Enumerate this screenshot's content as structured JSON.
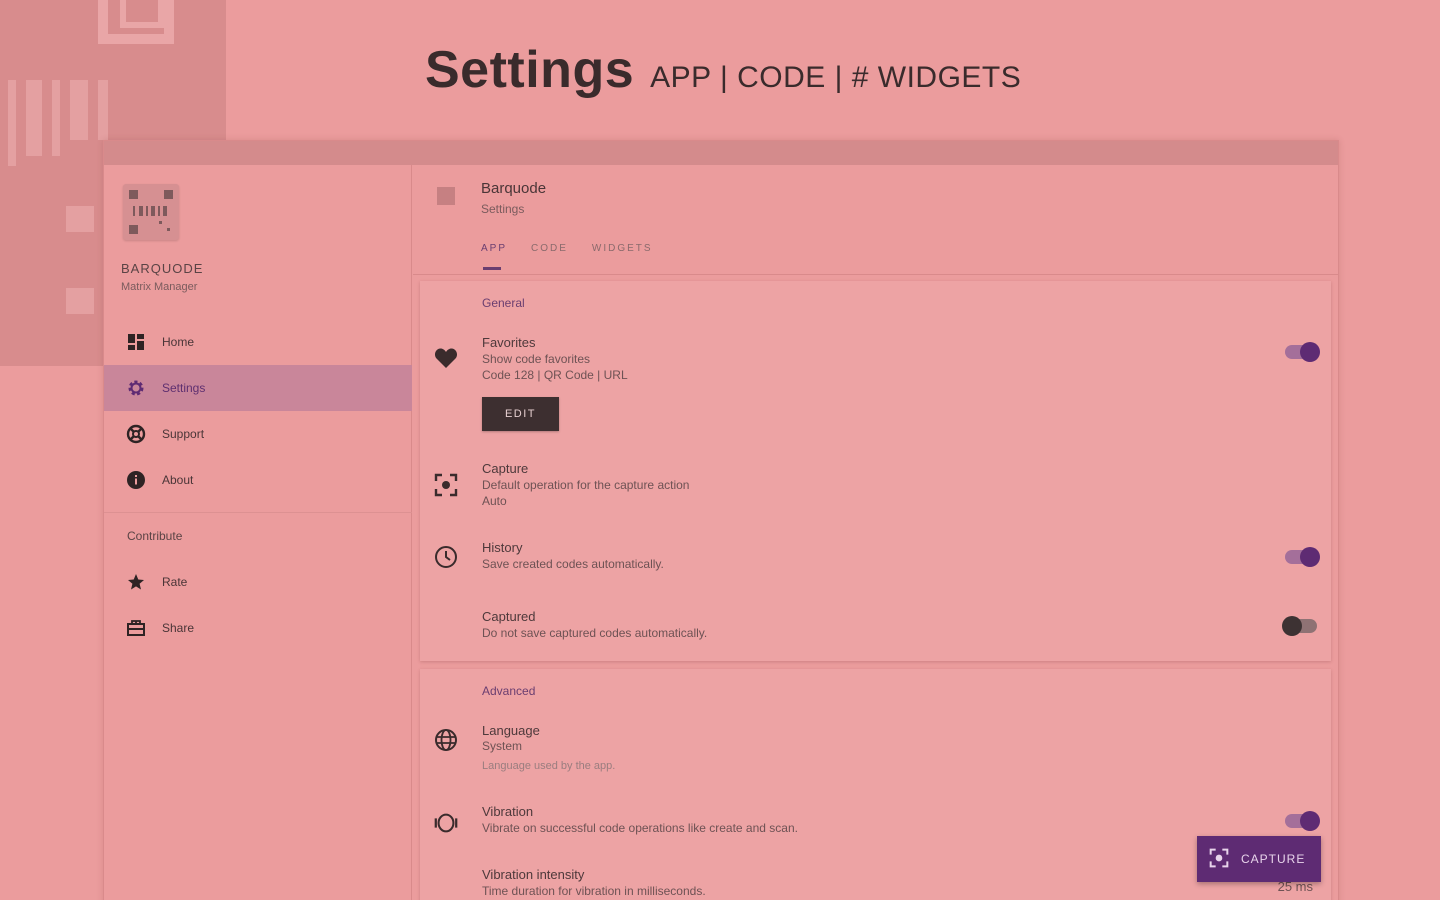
{
  "headline": {
    "title": "Settings",
    "subtitle": "APP | CODE | # WIDGETS"
  },
  "sidebar": {
    "brand_name": "BARQUODE",
    "brand_sub": "Matrix Manager",
    "nav": [
      {
        "label": "Home",
        "icon": "dashboard-icon"
      },
      {
        "label": "Settings",
        "icon": "gear-icon",
        "active": true
      },
      {
        "label": "Support",
        "icon": "lifebuoy-icon"
      },
      {
        "label": "About",
        "icon": "info-icon"
      }
    ],
    "contribute_label": "Contribute",
    "contribute": [
      {
        "label": "Rate",
        "icon": "star-icon"
      },
      {
        "label": "Share",
        "icon": "share-icon"
      }
    ]
  },
  "header": {
    "title": "Barquode",
    "subtitle": "Settings",
    "tabs": [
      "APP",
      "CODE",
      "WIDGETS"
    ],
    "active_tab": "APP"
  },
  "general": {
    "title": "General",
    "favorites": {
      "title": "Favorites",
      "line1": "Show code favorites",
      "line2": "Code 128 | QR Code | URL",
      "enabled": true,
      "edit_label": "EDIT"
    },
    "capture": {
      "title": "Capture",
      "line1": "Default operation for the capture action",
      "line2": "Auto"
    },
    "history": {
      "title": "History",
      "line1": "Save created codes automatically.",
      "enabled": true
    },
    "captured": {
      "title": "Captured",
      "line1": "Do not save captured codes automatically.",
      "enabled": false
    }
  },
  "advanced": {
    "title": "Advanced",
    "language": {
      "title": "Language",
      "line1": "System",
      "line2": "Language used by the app."
    },
    "vibration": {
      "title": "Vibration",
      "line1": "Vibrate on successful code operations like create and scan.",
      "enabled": true
    },
    "intensity": {
      "title": "Vibration intensity",
      "line1": "Time duration for vibration in milliseconds.",
      "value": "25 ms"
    }
  },
  "fab": {
    "label": "CAPTURE",
    "icon": "capture-icon"
  },
  "colors": {
    "background": "#eb9c9d",
    "accent": "#5e2b73",
    "active_nav": "#c9869a"
  }
}
